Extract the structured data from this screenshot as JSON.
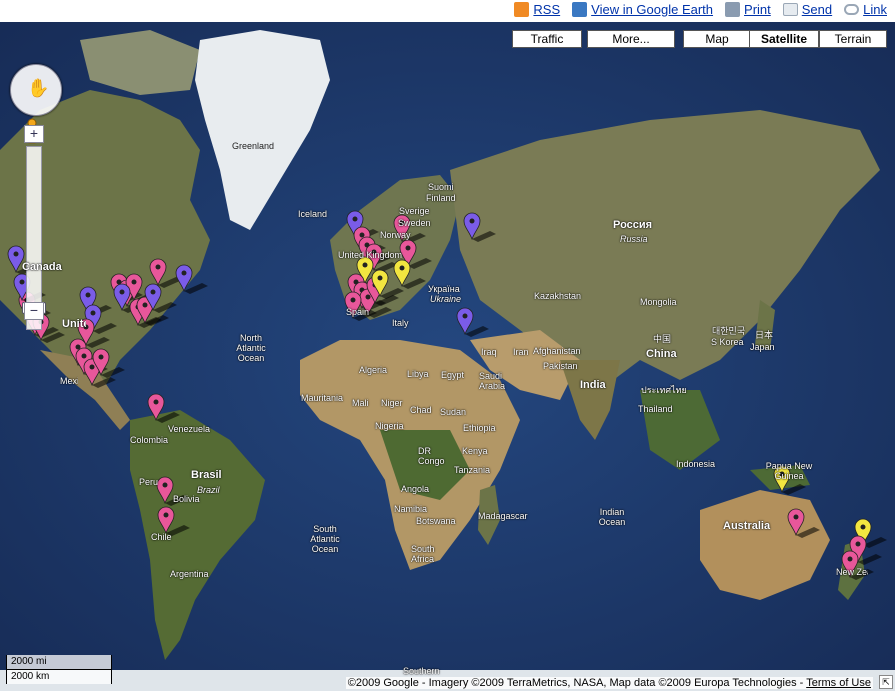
{
  "toolbar": {
    "links": [
      {
        "label": "RSS",
        "icon": "rss-icon",
        "color": "#f08a24"
      },
      {
        "label": "View in Google Earth",
        "icon": "google-earth-icon",
        "color": "#3a78c2"
      },
      {
        "label": "Print",
        "icon": "printer-icon",
        "color": "#8a9bb0"
      },
      {
        "label": "Send",
        "icon": "envelope-icon",
        "color": "#9aa7b6"
      },
      {
        "label": "Link",
        "icon": "chain-link-icon",
        "color": "#9aa7b6"
      }
    ]
  },
  "map_controls": {
    "traffic": "Traffic",
    "more": "More...",
    "map": "Map",
    "satellite": "Satellite",
    "terrain": "Terrain",
    "active_type": "Satellite",
    "zoom_in": "+",
    "zoom_out": "−"
  },
  "labels": {
    "greenland": "Greenland",
    "iceland": "Iceland",
    "suomi": "Suomi",
    "finland": "Finland",
    "sverige": "Sverige",
    "sweden": "Sweden",
    "norway": "Norway",
    "uk": "United Kingdom",
    "russia_ru": "Россия",
    "russia": "Russia",
    "ukraine_ua": "Україна",
    "ukraine": "Ukraine",
    "kazakhstan": "Kazakhstan",
    "mongolia": "Mongolia",
    "china_cn": "中国",
    "china": "China",
    "korea_kr": "대한민국",
    "korea": "S Korea",
    "japan_jp": "日本",
    "japan": "Japan",
    "canada": "Canada",
    "us": "United States",
    "mexico": "Mexico",
    "colombia": "Colombia",
    "venezuela": "Venezuela",
    "peru": "Peru",
    "brasil": "Brasil",
    "brazil": "Brazil",
    "bolivia": "Bolivia",
    "chile": "Chile",
    "argentina": "Argentina",
    "italy": "Italy",
    "spain": "Spain",
    "iraq": "Iraq",
    "iran": "Iran",
    "afghanistan": "Afghanistan",
    "pakistan": "Pakistan",
    "india": "India",
    "saudi": "Saudi Arabia",
    "egypt": "Egypt",
    "libya": "Libya",
    "algeria": "Algeria",
    "mauritania": "Mauritania",
    "mali": "Mali",
    "niger": "Niger",
    "chad": "Chad",
    "sudan": "Sudan",
    "nigeria": "Nigeria",
    "ethiopia": "Ethiopia",
    "drc": "DR Congo",
    "kenya": "Kenya",
    "tanzania": "Tanzania",
    "angola": "Angola",
    "namibia": "Namibia",
    "botswana": "Botswana",
    "south_africa": "South Africa",
    "madagascar": "Madagascar",
    "thailand": "Thailand",
    "thailand_th": "ประเทศไทย",
    "indonesia": "Indonesia",
    "png": "Papua New Guinea",
    "australia": "Australia",
    "new_zealand": "New Zealand",
    "north_atlantic": "North Atlantic Ocean",
    "south_atlantic": "South Atlantic Ocean",
    "indian_ocean": "Indian Ocean",
    "southern": "Southern"
  },
  "scale": {
    "miles": "2000 mi",
    "km": "2000 km"
  },
  "copyright": {
    "text": "©2009 Google - Imagery ©2009 TerraMetrics, NASA, Map data ©2009 Europa Technologies -",
    "terms": "Terms of Use"
  },
  "marker_colors": {
    "pink": "#e8579a",
    "purple": "#7a5ce8",
    "yellow": "#f2e640"
  },
  "colors": {
    "ocean": "#1f3a6e",
    "land": "#6f7a4a",
    "desert": "#b59a6a",
    "ice": "#e8ecef"
  }
}
